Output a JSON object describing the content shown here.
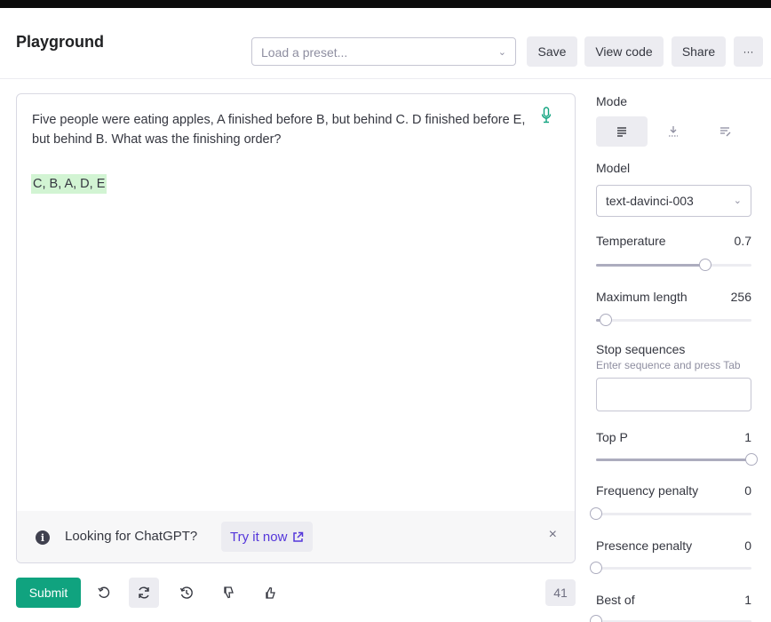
{
  "header": {
    "title": "Playground",
    "preset_placeholder": "Load a preset...",
    "save_label": "Save",
    "view_code_label": "View code",
    "share_label": "Share",
    "more_label": "···"
  },
  "editor": {
    "prompt_text": "Five people were eating apples, A finished before B, but behind C. D finished before E, but behind B. What was the finishing order?",
    "completion_text": "C, B, A, D, E",
    "banner": {
      "text": "Looking for ChatGPT?",
      "link_label": "Try it now",
      "close_label": "×",
      "info_glyph": "i"
    }
  },
  "footer": {
    "submit_label": "Submit",
    "token_count": "41"
  },
  "settings": {
    "mode_label": "Mode",
    "model_label": "Model",
    "model_value": "text-davinci-003",
    "temperature": {
      "label": "Temperature",
      "value": "0.7",
      "fraction": 0.7
    },
    "maximum_length": {
      "label": "Maximum length",
      "value": "256",
      "fraction": 0.06
    },
    "stop_sequences": {
      "label": "Stop sequences",
      "hint": "Enter sequence and press Tab"
    },
    "top_p": {
      "label": "Top P",
      "value": "1",
      "fraction": 1.0
    },
    "frequency_penalty": {
      "label": "Frequency penalty",
      "value": "0",
      "fraction": 0
    },
    "presence_penalty": {
      "label": "Presence penalty",
      "value": "0",
      "fraction": 0
    },
    "best_of": {
      "label": "Best of",
      "value": "1",
      "fraction": 0
    }
  },
  "colors": {
    "accent_green": "#10a37f",
    "completion_highlight": "#d2f4d3",
    "link_purple": "#5436da"
  }
}
